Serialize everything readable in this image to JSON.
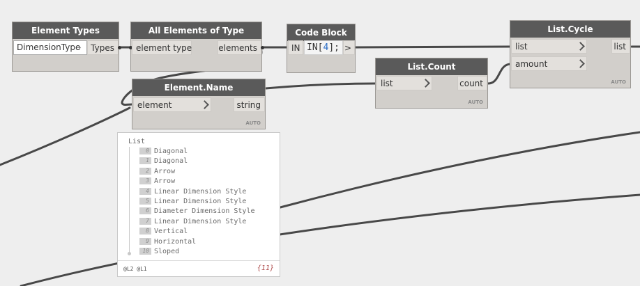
{
  "nodes": {
    "element_types": {
      "title": "Element Types",
      "dropdown_value": "DimensionType",
      "output": "Types"
    },
    "all_elements": {
      "title": "All Elements of Type",
      "input": "element type",
      "output": "elements"
    },
    "code_block": {
      "title": "Code Block",
      "input": "IN",
      "code_prefix": "IN[",
      "code_index": "4",
      "code_suffix": "];",
      "output": ">"
    },
    "list_count": {
      "title": "List.Count",
      "input": "list",
      "output": "count",
      "lacing": "AUTO"
    },
    "list_cycle": {
      "title": "List.Cycle",
      "input_list": "list",
      "input_amount": "amount",
      "output": "list",
      "lacing": "AUTO"
    },
    "element_name": {
      "title": "Element.Name",
      "input": "element",
      "output": "string",
      "lacing": "AUTO"
    }
  },
  "preview": {
    "title": "List",
    "items": [
      {
        "index": "0",
        "value": "Diagonal"
      },
      {
        "index": "1",
        "value": "Diagonal"
      },
      {
        "index": "2",
        "value": "Arrow"
      },
      {
        "index": "3",
        "value": "Arrow"
      },
      {
        "index": "4",
        "value": "Linear Dimension Style"
      },
      {
        "index": "5",
        "value": "Linear Dimension Style"
      },
      {
        "index": "6",
        "value": "Diameter Dimension Style"
      },
      {
        "index": "7",
        "value": "Linear Dimension Style"
      },
      {
        "index": "8",
        "value": "Vertical"
      },
      {
        "index": "9",
        "value": "Horizontal"
      },
      {
        "index": "10",
        "value": "Sloped"
      }
    ],
    "levels": "@L2 @L1",
    "count": "{11}"
  }
}
